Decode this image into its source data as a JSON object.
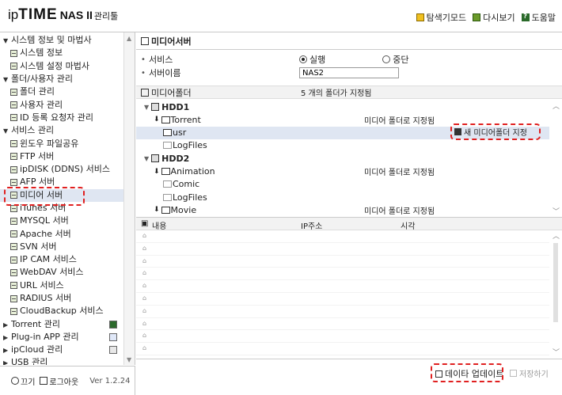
{
  "app": {
    "brand_ip": "ip",
    "brand_time": "TIME",
    "brand_model": "NAS II",
    "brand_tool": "관리툴"
  },
  "header_links": [
    {
      "icon": "explorer-mode-icon",
      "label": "탐색기모드"
    },
    {
      "icon": "refresh-icon",
      "label": "다시보기"
    },
    {
      "icon": "help-icon",
      "label": "도움말"
    }
  ],
  "sidebar": {
    "items": [
      {
        "type": "group",
        "expanded": true,
        "label": "시스템 정보 및 마법사"
      },
      {
        "type": "sub",
        "label": "시스템 정보"
      },
      {
        "type": "sub",
        "label": "시스템 설정 마법사"
      },
      {
        "type": "group",
        "expanded": true,
        "label": "폴더/사용자 관리"
      },
      {
        "type": "sub",
        "label": "폴더 관리"
      },
      {
        "type": "sub",
        "label": "사용자 관리"
      },
      {
        "type": "sub",
        "label": "ID 등록 요청자 관리"
      },
      {
        "type": "group",
        "expanded": true,
        "label": "서비스 관리"
      },
      {
        "type": "sub",
        "label": "윈도우 파일공유"
      },
      {
        "type": "sub",
        "label": "FTP 서버"
      },
      {
        "type": "sub",
        "label": "ipDISK (DDNS) 서비스"
      },
      {
        "type": "sub",
        "label": "AFP 서버"
      },
      {
        "type": "sub",
        "label": "미디어 서버",
        "selected": true
      },
      {
        "type": "sub",
        "label": "iTunes 서버"
      },
      {
        "type": "sub",
        "label": "MYSQL 서버"
      },
      {
        "type": "sub",
        "label": "Apache 서버"
      },
      {
        "type": "sub",
        "label": "SVN 서버"
      },
      {
        "type": "sub",
        "label": "IP CAM 서비스"
      },
      {
        "type": "sub",
        "label": "WebDAV 서비스"
      },
      {
        "type": "sub",
        "label": "URL 서비스"
      },
      {
        "type": "sub",
        "label": "RADIUS 서버"
      },
      {
        "type": "sub",
        "label": "CloudBackup 서비스"
      },
      {
        "type": "group",
        "expanded": false,
        "label": "Torrent 관리",
        "badge": "b1"
      },
      {
        "type": "group",
        "expanded": false,
        "label": "Plug-in APP 관리",
        "badge": "b2"
      },
      {
        "type": "group",
        "expanded": false,
        "label": "ipCloud 관리",
        "badge": "b3"
      },
      {
        "type": "group",
        "expanded": false,
        "label": "USB 관리"
      }
    ]
  },
  "footer": {
    "power_label": "끄기",
    "logout_label": "로그아웃",
    "version": "Ver 1.2.24"
  },
  "main": {
    "title": "미디어서버",
    "service_label": "서비스",
    "service_on": "실행",
    "service_off": "중단",
    "name_label": "서버이름",
    "name_value": "NAS2",
    "folder_section": "미디어폴더",
    "folder_count_text": "5 개의 폴더가 지정됨",
    "tree": [
      {
        "kind": "hdd",
        "label": "HDD1",
        "indent": 0
      },
      {
        "kind": "folder",
        "label": "Torrent",
        "indent": 1,
        "download": true,
        "status": "미디어 폴더로 지정됨"
      },
      {
        "kind": "folder",
        "label": "usr",
        "indent": 2,
        "selected": true,
        "status": ""
      },
      {
        "kind": "folder",
        "label": "LogFiles",
        "indent": 2,
        "gray": true,
        "status": ""
      },
      {
        "kind": "hdd",
        "label": "HDD2",
        "indent": 0
      },
      {
        "kind": "folder",
        "label": "Animation",
        "indent": 1,
        "download": true,
        "status": "미디어 폴더로 지정됨"
      },
      {
        "kind": "folder",
        "label": "Comic",
        "indent": 2,
        "gray": true,
        "status": ""
      },
      {
        "kind": "folder",
        "label": "LogFiles",
        "indent": 2,
        "gray": true,
        "status": ""
      },
      {
        "kind": "folder",
        "label": "Movie",
        "indent": 1,
        "download": true,
        "status": "미디어 폴더로 지정됨"
      }
    ],
    "new_folder_button": "새 미디어폴더 지정",
    "log_columns": {
      "content": "내용",
      "ip": "IP주소",
      "time": "시각"
    },
    "log_row_count": 10,
    "update_button": "데이타 업데이트",
    "save_button": "저장하기"
  }
}
